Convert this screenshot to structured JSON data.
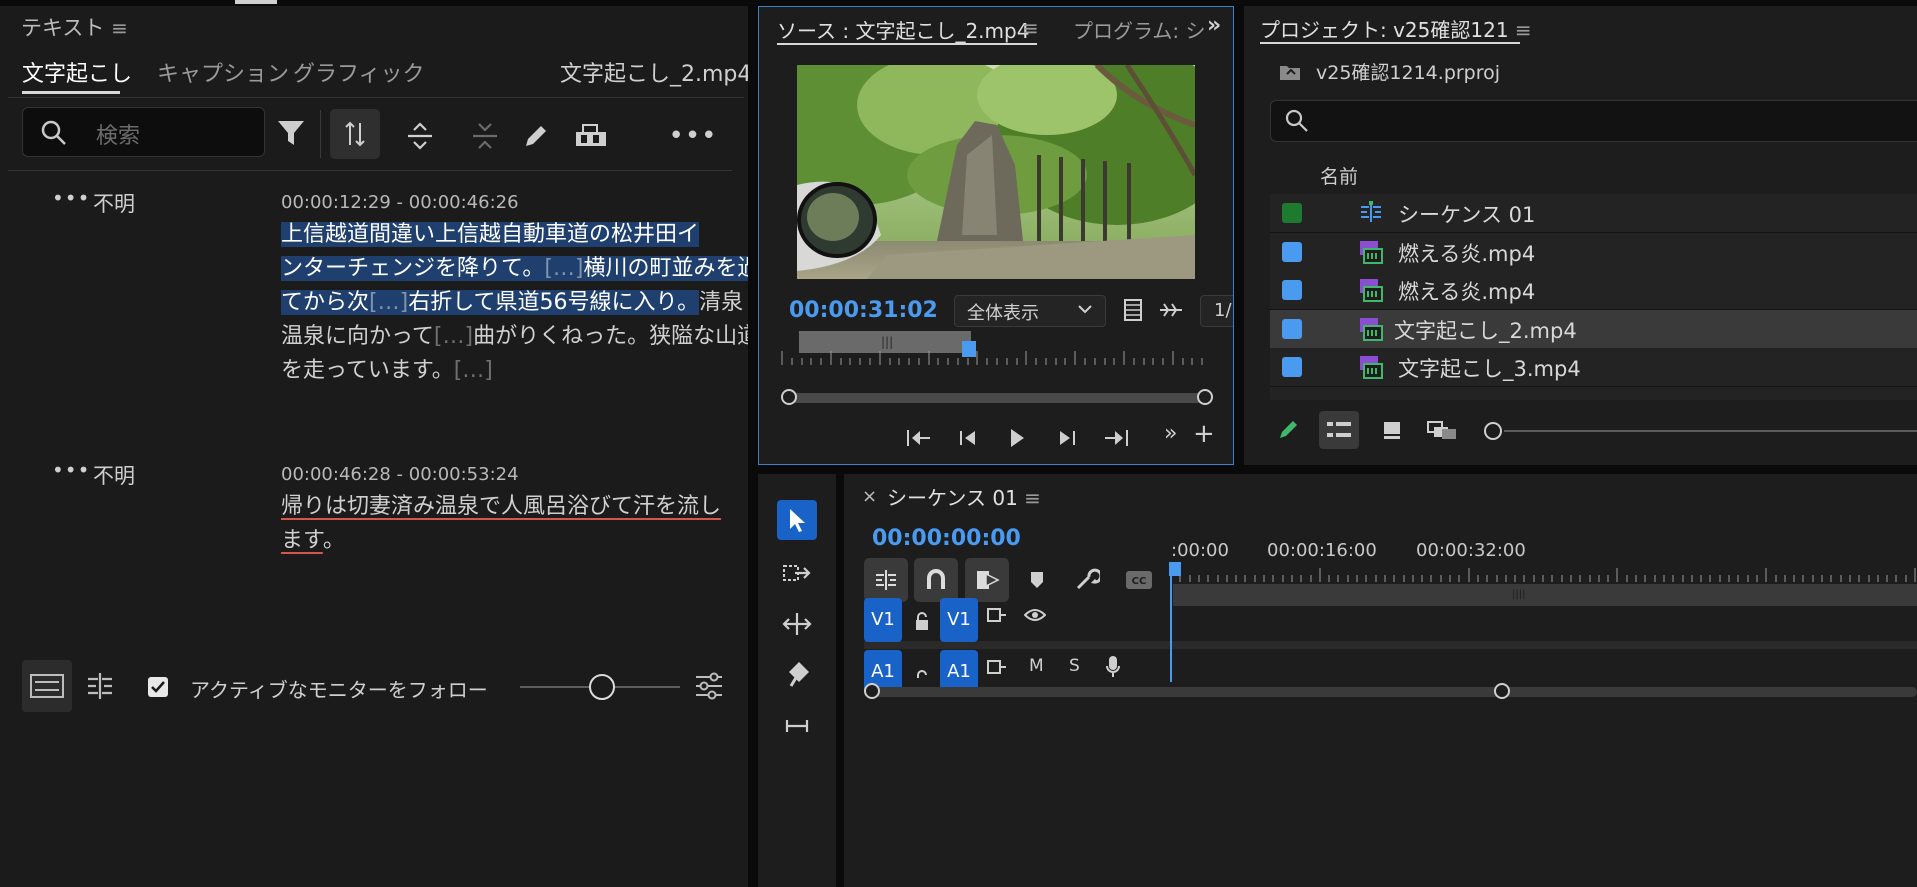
{
  "text_panel": {
    "title": "テキスト",
    "tabs": [
      "文字起こし",
      "キャプション",
      "グラフィック"
    ],
    "clip_name": "文字起こし_2.mp4",
    "search_placeholder": "検索",
    "segments": [
      {
        "speaker": "不明",
        "timecode": "00:00:12:29 - 00:00:46:26",
        "lines": [
          {
            "parts": [
              {
                "t": "上信越道間違い上信越自動車道の松井田イ",
                "c": "hl"
              }
            ]
          },
          {
            "parts": [
              {
                "t": "ンターチェンジを降りて。",
                "c": "hl"
              },
              {
                "t": "[…]",
                "c": "hl ell"
              },
              {
                "t": "横川の町並みを過ぎ",
                "c": "hl"
              }
            ]
          },
          {
            "parts": [
              {
                "t": "てから次",
                "c": "hl"
              },
              {
                "t": "[…]",
                "c": "hl ell"
              },
              {
                "t": "右折して県道56号線に入り。",
                "c": "hl"
              },
              {
                "t": "清泉",
                "c": ""
              }
            ]
          },
          {
            "parts": [
              {
                "t": "温泉に向かって",
                "c": ""
              },
              {
                "t": "[…]",
                "c": "ell2"
              },
              {
                "t": "曲がりくねった。狭隘な山道",
                "c": ""
              }
            ]
          },
          {
            "parts": [
              {
                "t": "を走っています。",
                "c": ""
              },
              {
                "t": "[…]",
                "c": "ell2"
              }
            ]
          }
        ]
      },
      {
        "speaker": "不明",
        "timecode": "00:00:46:28 - 00:00:53:24",
        "lines": [
          {
            "parts": [
              {
                "t": "帰りは切妻済み温泉で人風呂浴びて汗を流し",
                "c": "squig"
              }
            ]
          },
          {
            "parts": [
              {
                "t": "ます",
                "c": "squig"
              },
              {
                "t": "。",
                "c": ""
              }
            ]
          }
        ]
      }
    ],
    "follow_monitor_label": "アクティブなモニターをフォロー",
    "follow_monitor_checked": true
  },
  "source_monitor": {
    "tab_source": "ソース : 文字起こし_2.mp4",
    "tab_program": "プログラム: シ",
    "timecode": "00:00:31:02",
    "zoom_select": "全体表示",
    "resolution_partial": "1/"
  },
  "project_panel": {
    "tab": "プロジェクト: v25確認121",
    "project_file": "v25確認1214.prproj",
    "name_header": "名前",
    "items": [
      {
        "name": "シーケンス 01",
        "color": "#1e7a2e",
        "type": "sequence"
      },
      {
        "name": "燃える炎.mp4",
        "color": "#4a9bf0",
        "type": "clip"
      },
      {
        "name": "燃える炎.mp4",
        "color": "#4a9bf0",
        "type": "clip"
      },
      {
        "name": "文字起こし_2.mp4",
        "color": "#4a9bf0",
        "type": "clip",
        "selected": true
      },
      {
        "name": "文字起こし_3.mp4",
        "color": "#4a9bf0",
        "type": "clip"
      }
    ]
  },
  "timeline": {
    "tab": "シーケンス 01",
    "timecode": "00:00:00:00",
    "ruler_labels": [
      ":00:00",
      "00:00:16:00",
      "00:00:32:00"
    ],
    "tracks": [
      {
        "src": "V1",
        "dst": "V1"
      },
      {
        "src": "A1",
        "dst": "A1",
        "m": "M",
        "s": "S"
      }
    ]
  },
  "colors": {
    "accent": "#4a9bf0",
    "panel_bg": "#1d1d1d",
    "highlight": "#1f3f6e",
    "track_button": "#1862c8"
  }
}
